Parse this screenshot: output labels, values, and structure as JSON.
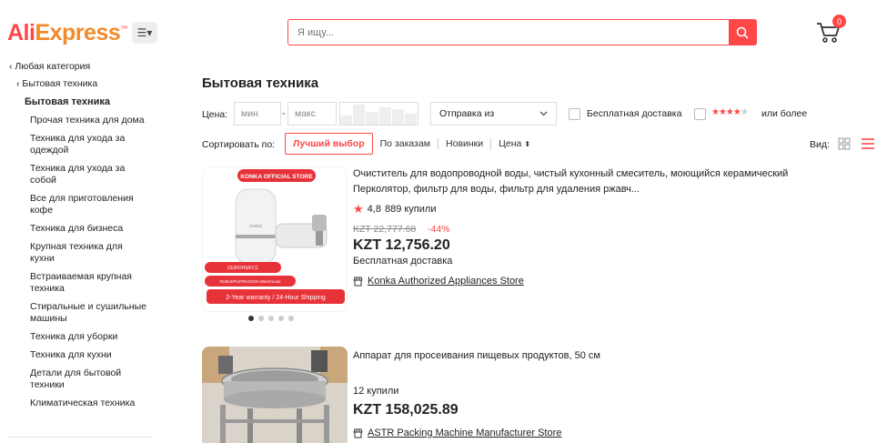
{
  "header": {
    "logo_ali": "Ali",
    "logo_express": "Express",
    "logo_tm": "™",
    "search_placeholder": "Я ищу...",
    "cart_count": "0",
    "brand_color": "#ff4747"
  },
  "sidebar": {
    "back_all": "Любая категория",
    "back_parent": "Бытовая техника",
    "current": "Бытовая техника",
    "items": [
      "Прочая техника для дома",
      "Техника для ухода за одеждой",
      "Техника для ухода за собой",
      "Все для приготовления кофе",
      "Техника для бизнеса",
      "Крупная техника для кухни",
      "Встраиваемая крупная техника",
      "Стиральные и сушильные машины",
      "Техника для уборки",
      "Техника для кухни",
      "Детали для бытовой техники",
      "Климатическая техника"
    ]
  },
  "main": {
    "title": "Бытовая техника",
    "filters": {
      "price_label": "Цена:",
      "min_placeholder": "мин",
      "dash": "-",
      "max_placeholder": "макс",
      "ship_from": "Отправка из",
      "free_shipping": "Бесплатная доставка",
      "rating_suffix": "или более"
    },
    "sort": {
      "label": "Сортировать по:",
      "options": [
        "Лучший выбор",
        "По заказам",
        "Новинки",
        "Цена"
      ],
      "active": "Лучший выбор"
    },
    "view_label": "Вид:"
  },
  "products": [
    {
      "title": "Очиститель для водопроводной воды, чистый кухонный смеситель, моющийся керамический Перколятор, фильтр для воды, фильтр для удаления ржавч...",
      "rating": "4,8",
      "sold": "889 купили",
      "old_price": "KZT 22,777.68",
      "discount": "-44%",
      "price": "KZT 12,756.20",
      "shipping": "Бесплатная доставка",
      "store": "Konka Authorized Appliances Store",
      "img_badge": "KONKA OFFICIAL STORE",
      "img_brand": "konka",
      "img_cert1": "CE/ROHS/FCC",
      "img_cert2": "RU/ES/PL/FR/US/CN Warehouse",
      "img_warranty": "2-Year warranty / 24-Hour Shipping"
    },
    {
      "title": "Аппарат для просеивания пищевых продуктов, 50 см",
      "sold": "12 купили",
      "price": "KZT 158,025.89",
      "store": "ASTR Packing Machine Manufacturer Store"
    }
  ]
}
